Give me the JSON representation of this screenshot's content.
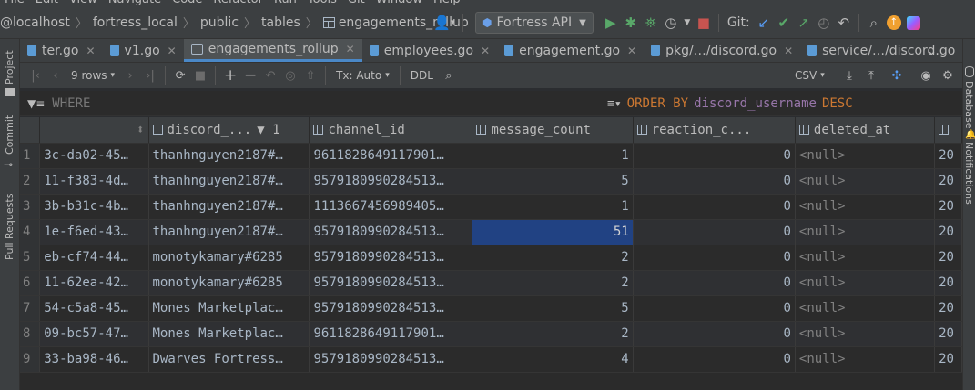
{
  "menu": [
    "File",
    "Edit",
    "View",
    "Navigate",
    "Code",
    "Refactor",
    "Run",
    "Tools",
    "Git",
    "Window",
    "Help"
  ],
  "breadcrumbs": [
    "@localhost",
    "fortress_local",
    "public",
    "tables",
    "engagements_rollup"
  ],
  "run_config": "Fortress API",
  "git_label": "Git:",
  "tabs": [
    {
      "label": "ter.go",
      "type": "go",
      "closable": true
    },
    {
      "label": "v1.go",
      "type": "go",
      "closable": true
    },
    {
      "label": "engagements_rollup",
      "type": "table",
      "closable": true,
      "active": true
    },
    {
      "label": "employees.go",
      "type": "go",
      "closable": true
    },
    {
      "label": "engagement.go",
      "type": "go",
      "closable": true
    },
    {
      "label": "pkg/…/discord.go",
      "type": "go",
      "closable": true
    },
    {
      "label": "service/…/discord.go",
      "type": "go",
      "closable": true
    }
  ],
  "left_tools": [
    "Project",
    "Commit",
    "Pull Requests"
  ],
  "right_tools": [
    "Database",
    "Notifications"
  ],
  "toolbar": {
    "rows": "9 rows",
    "tx": "Tx: Auto",
    "ddl": "DDL",
    "export": "CSV"
  },
  "filter": {
    "where_placeholder": "WHERE",
    "order_kw": "ORDER BY",
    "order_col": "discord_username",
    "order_dir": "DESC"
  },
  "columns": [
    {
      "label": "",
      "sort": ""
    },
    {
      "label": "discord_...",
      "sort": "▼ 1"
    },
    {
      "label": "channel_id",
      "sort": ""
    },
    {
      "label": "message_count",
      "sort": ""
    },
    {
      "label": "reaction_c...",
      "sort": ""
    },
    {
      "label": "deleted_at",
      "sort": ""
    },
    {
      "label": "",
      "sort": ""
    }
  ],
  "rows": [
    {
      "n": "1",
      "id": "3c-da02-45…",
      "user": "thanhnguyen2187#…",
      "channel": "9611828649117901…",
      "msg": "1",
      "react": "0",
      "deleted": "<null>",
      "extra": "20"
    },
    {
      "n": "2",
      "id": "11-f383-4d…",
      "user": "thanhnguyen2187#…",
      "channel": "9579180990284513…",
      "msg": "5",
      "react": "0",
      "deleted": "<null>",
      "extra": "20"
    },
    {
      "n": "3",
      "id": "3b-b31c-4b…",
      "user": "thanhnguyen2187#…",
      "channel": "1113667456989405…",
      "msg": "1",
      "react": "0",
      "deleted": "<null>",
      "extra": "20"
    },
    {
      "n": "4",
      "id": "1e-f6ed-43…",
      "user": "thanhnguyen2187#…",
      "channel": "9579180990284513…",
      "msg": "51",
      "react": "0",
      "deleted": "<null>",
      "extra": "20"
    },
    {
      "n": "5",
      "id": "eb-cf74-44…",
      "user": "monotykamary#6285",
      "channel": "9579180990284513…",
      "msg": "2",
      "react": "0",
      "deleted": "<null>",
      "extra": "20"
    },
    {
      "n": "6",
      "id": "11-62ea-42…",
      "user": "monotykamary#6285",
      "channel": "9579180990284513…",
      "msg": "2",
      "react": "0",
      "deleted": "<null>",
      "extra": "20"
    },
    {
      "n": "7",
      "id": "54-c5a8-45…",
      "user": "Mones Marketplac…",
      "channel": "9579180990284513…",
      "msg": "5",
      "react": "0",
      "deleted": "<null>",
      "extra": "20"
    },
    {
      "n": "8",
      "id": "09-bc57-47…",
      "user": "Mones Marketplac…",
      "channel": "9611828649117901…",
      "msg": "2",
      "react": "0",
      "deleted": "<null>",
      "extra": "20"
    },
    {
      "n": "9",
      "id": "33-ba98-46…",
      "user": "Dwarves Fortress…",
      "channel": "9579180990284513…",
      "msg": "4",
      "react": "0",
      "deleted": "<null>",
      "extra": "20"
    }
  ],
  "selected_cell": {
    "row": 4,
    "column": "message_count"
  },
  "colors": {
    "selection": "#214283",
    "keyword": "#cc7832",
    "column_ref": "#9876aa",
    "accent": "#4a88c7"
  }
}
